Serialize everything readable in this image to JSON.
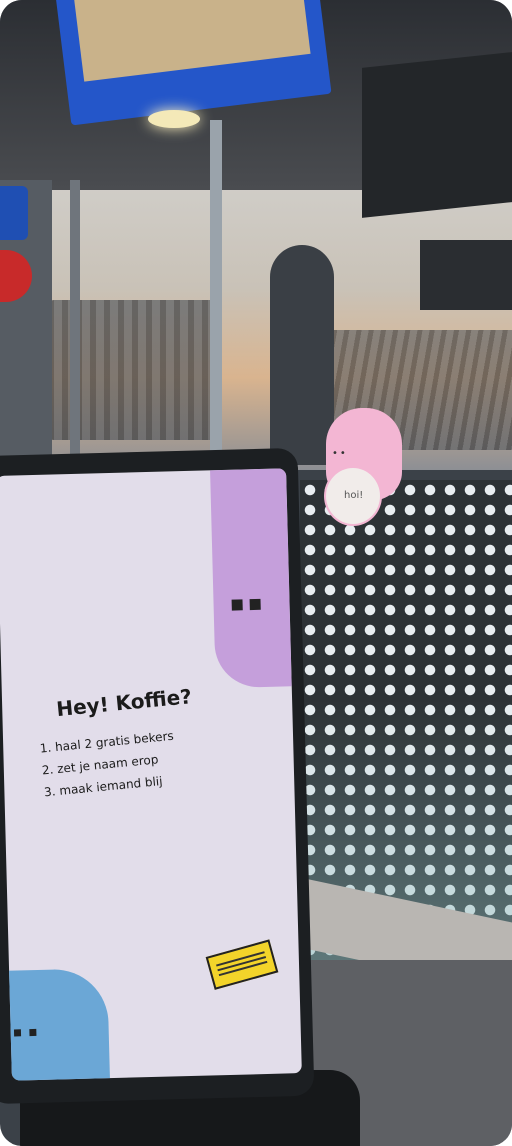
{
  "poster": {
    "headline": "Hey! Koffie?",
    "steps": [
      "1. haal 2 gratis bekers",
      "2. zet je naam erop",
      "3. maak iemand blij"
    ]
  },
  "window_sticker": {
    "bubble_text": "hoi!"
  },
  "colors": {
    "poster_background": "#e2ddea",
    "purple_shape": "#c59fdb",
    "blue_shape": "#6ba7d6",
    "pink_sticker": "#f3b6d3",
    "label_yellow": "#f3d42a"
  }
}
